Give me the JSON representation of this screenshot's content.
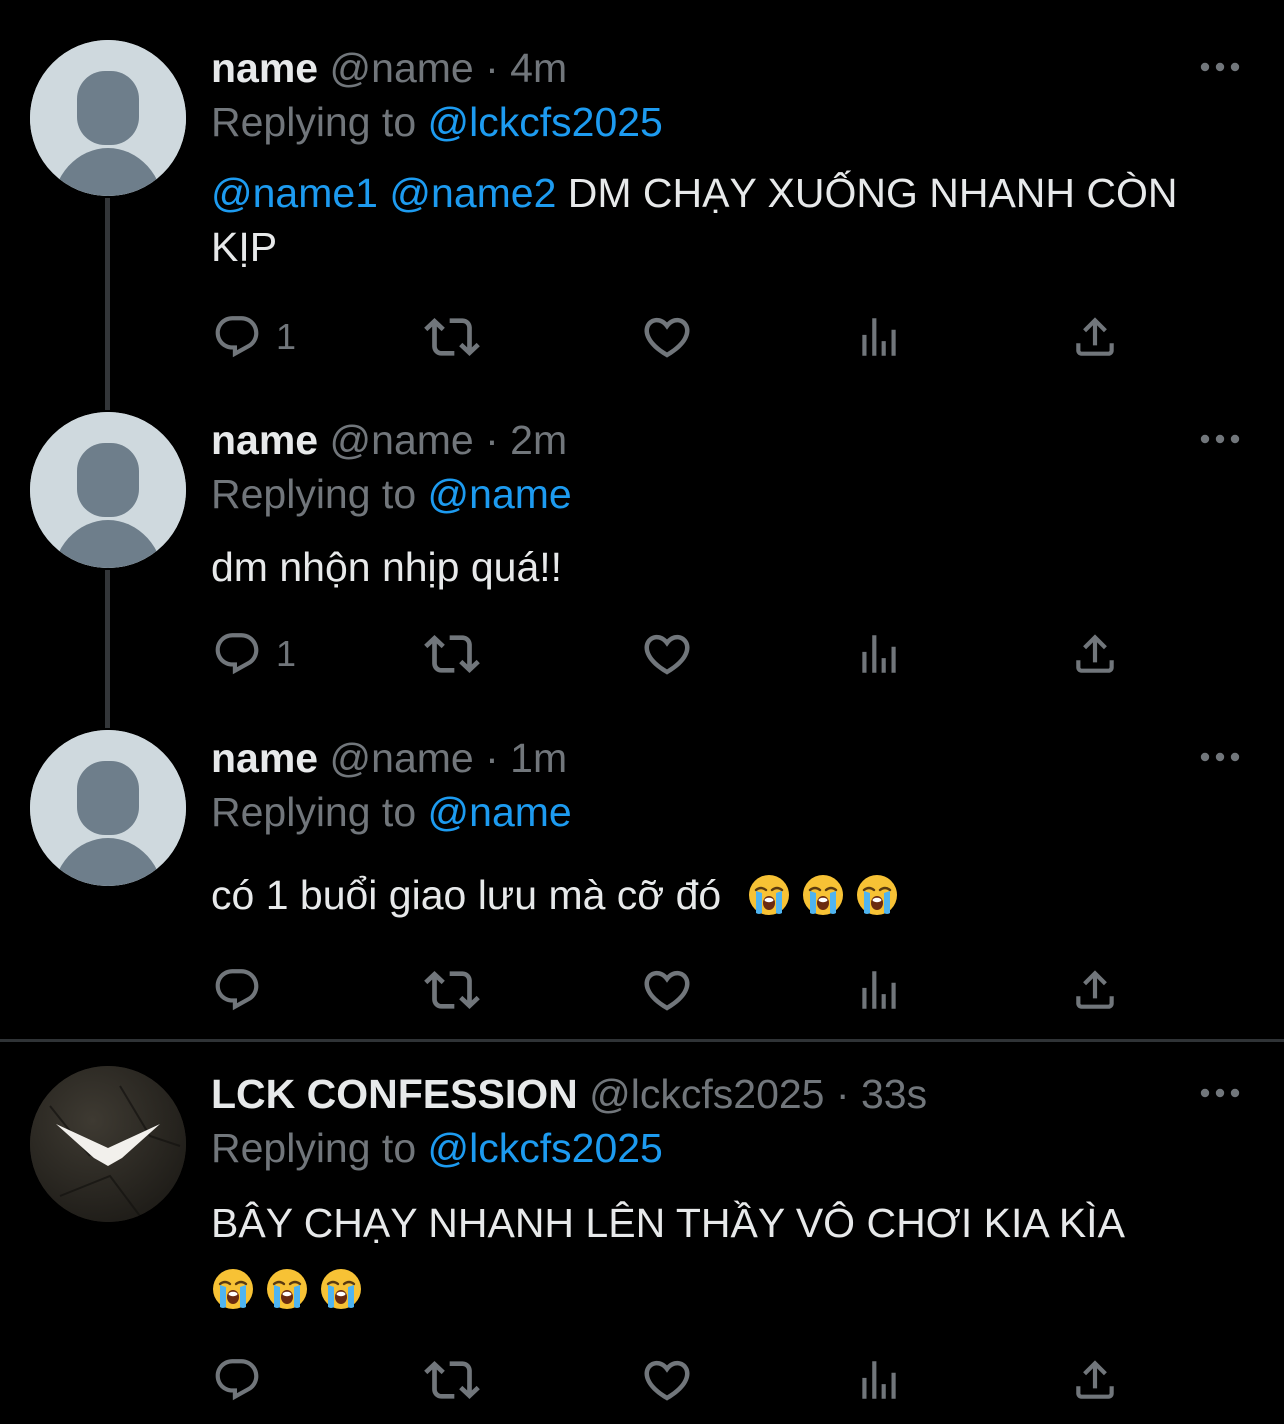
{
  "tweets": [
    {
      "display_name": "name",
      "handle": "@name",
      "time": "4m",
      "replying_label": "Replying to",
      "replying_to": "@lckcfs2025",
      "mention1": "@name1",
      "mention2": "@name2",
      "text": "DM CHẠY XUỐNG NHANH CÒN KỊP",
      "reply_count": "1",
      "avatar": "default-avatar"
    },
    {
      "display_name": "name",
      "handle": "@name",
      "time": "2m",
      "replying_label": "Replying to",
      "replying_to": "@name",
      "text": "dm nhộn nhịp quá!!",
      "reply_count": "1",
      "avatar": "default-avatar"
    },
    {
      "display_name": "name",
      "handle": "@name",
      "time": "1m",
      "replying_label": "Replying to",
      "replying_to": "@name",
      "text": "có 1 buổi giao lưu mà cỡ đó",
      "emoji": "loudly-crying-face",
      "reply_count": "",
      "avatar": "default-avatar"
    },
    {
      "display_name": "LCK CONFESSION",
      "handle": "@lckcfs2025",
      "time": "33s",
      "replying_label": "Replying to",
      "replying_to": "@lckcfs2025",
      "text": "BÂY CHẠY NHANH LÊN THẦY VÔ CHƠI KIA KÌA",
      "emoji": "loudly-crying-face",
      "reply_count": "",
      "avatar": "wing-logo-avatar"
    }
  ],
  "separator": "·",
  "icons": {
    "reply": "reply-icon",
    "retweet": "retweet-icon",
    "like": "heart-icon",
    "views": "views-icon",
    "share": "share-icon",
    "more": "more-icon"
  },
  "colors": {
    "background": "#000000",
    "text": "#e7e9ea",
    "muted": "#71767b",
    "link": "#1d9bf0",
    "thread_line": "#333639",
    "divider": "#2f3336"
  }
}
